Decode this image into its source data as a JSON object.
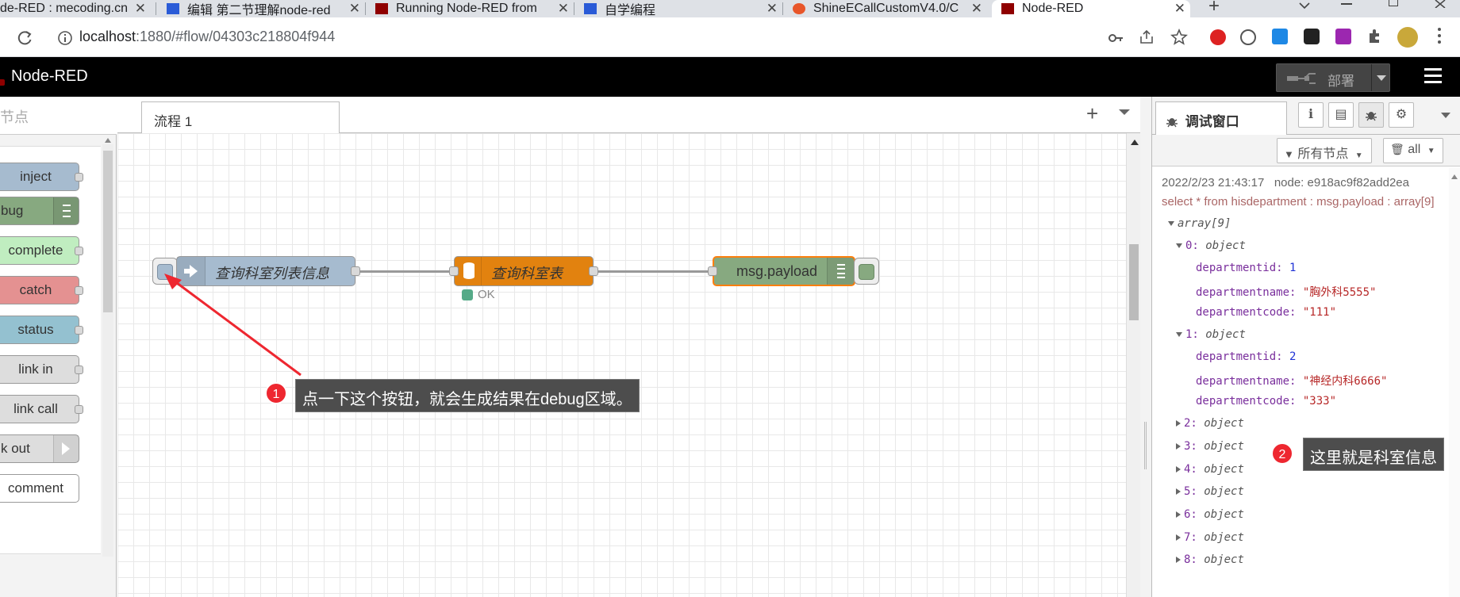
{
  "browser": {
    "tabs": [
      {
        "title": "de-RED : mecoding.cn",
        "close": "✕"
      },
      {
        "title": "编辑 第二节理解node-red",
        "close": "✕"
      },
      {
        "title": "Running Node-RED from",
        "close": "✕"
      },
      {
        "title": "自学编程",
        "close": "✕"
      },
      {
        "title": "ShineECallCustomV4.0/C",
        "close": "✕"
      },
      {
        "title": "Node-RED",
        "close": "✕"
      }
    ],
    "new_tab": "+",
    "url_host": "localhost",
    "url_path": ":1880/#flow/04303c218804f944"
  },
  "header": {
    "title": "Node-RED",
    "deploy_label": "部署"
  },
  "palette": {
    "search_placeholder": "节点",
    "nodes": [
      {
        "label": "inject",
        "color": "#a6bbcf"
      },
      {
        "label": "bug",
        "color": "#87a980"
      },
      {
        "label": "complete",
        "color": "#c0edc0"
      },
      {
        "label": "catch",
        "color": "#e49191"
      },
      {
        "label": "status",
        "color": "#94c1d0"
      },
      {
        "label": "link in",
        "color": "#dddddd"
      },
      {
        "label": "link call",
        "color": "#dddddd"
      },
      {
        "label": "k out",
        "color": "#dddddd"
      },
      {
        "label": "comment",
        "color": "#ffffff"
      }
    ]
  },
  "workspace": {
    "tab_label": "流程 1",
    "add_label": "+",
    "nodes": {
      "inject": {
        "label": "查询科室列表信息",
        "color": "#a6bbcf"
      },
      "mysql": {
        "label": "查询科室表",
        "color": "#e2820f",
        "status": "OK"
      },
      "debug": {
        "label": "msg.payload",
        "color": "#87a980"
      }
    }
  },
  "annotations": [
    {
      "number": "1",
      "text": "点一下这个按钮，就会生成结果在debug区域。"
    },
    {
      "number": "2",
      "text": "这里就是科室信息"
    }
  ],
  "sidebar": {
    "tab_label": "调试窗口",
    "filter_label": "所有节点",
    "clear_label": "all",
    "message": {
      "timestamp": "2022/2/23 21:43:17",
      "node": "node: e918ac9f82add2ea",
      "topic": "select * from hisdepartment : msg.payload : array[9]",
      "root": "array[9]",
      "items": [
        {
          "key": "0:",
          "type": "object",
          "expanded": true,
          "fields": [
            {
              "name": "departmentid:",
              "value": "1",
              "kind": "num"
            },
            {
              "name": "departmentname:",
              "value": "\"胸外科5555\"",
              "kind": "str"
            },
            {
              "name": "departmentcode:",
              "value": "\"111\"",
              "kind": "str"
            }
          ]
        },
        {
          "key": "1:",
          "type": "object",
          "expanded": true,
          "fields": [
            {
              "name": "departmentid:",
              "value": "2",
              "kind": "num"
            },
            {
              "name": "departmentname:",
              "value": "\"神经内科6666\"",
              "kind": "str"
            },
            {
              "name": "departmentcode:",
              "value": "\"333\"",
              "kind": "str"
            }
          ]
        },
        {
          "key": "2:",
          "type": "object",
          "expanded": false
        },
        {
          "key": "3:",
          "type": "object",
          "expanded": false
        },
        {
          "key": "4:",
          "type": "object",
          "expanded": false
        },
        {
          "key": "5:",
          "type": "object",
          "expanded": false
        },
        {
          "key": "6:",
          "type": "object",
          "expanded": false
        },
        {
          "key": "7:",
          "type": "object",
          "expanded": false
        },
        {
          "key": "8:",
          "type": "object",
          "expanded": false
        }
      ]
    }
  },
  "colors": {
    "accent_red": "#ee2730",
    "header_bg": "#000000",
    "deploy_bg": "#444444"
  }
}
